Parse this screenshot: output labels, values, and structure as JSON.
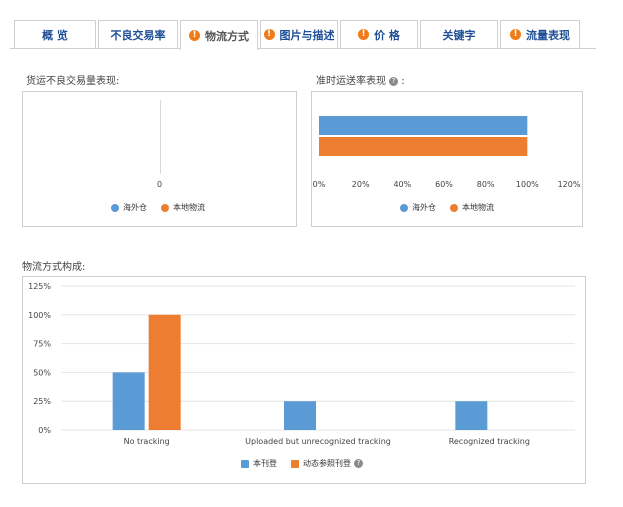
{
  "tabs": [
    {
      "label": "概 览",
      "warning": false
    },
    {
      "label": "不良交易率",
      "warning": false
    },
    {
      "label": "物流方式",
      "warning": true,
      "active": true
    },
    {
      "label": "图片与描述",
      "warning": true
    },
    {
      "label": "价 格",
      "warning": true
    },
    {
      "label": "关键字",
      "warning": false
    },
    {
      "label": "流量表现",
      "warning": true
    }
  ],
  "colors": {
    "blue": "#5b9bd5",
    "orange": "#ed7d31",
    "tab_text": "#1f4f96",
    "warning": "#f07b19"
  },
  "bad_trade": {
    "title": "货运不良交易量表现:",
    "zero_label": "0",
    "legend": [
      "海外仓",
      "本地物流"
    ]
  },
  "ontime": {
    "title": "准时运送率表现",
    "title_suffix": ":",
    "legend": [
      "海外仓",
      "本地物流"
    ]
  },
  "composition": {
    "title": "物流方式构成:",
    "legend": [
      "本刊登",
      "动态参照刊登"
    ]
  },
  "chart_data": [
    {
      "type": "bar",
      "orientation": "horizontal",
      "title": "准时运送率表现",
      "x_ticks": [
        "0%",
        "20%",
        "40%",
        "60%",
        "80%",
        "100%",
        "120%"
      ],
      "xlim": [
        0,
        120
      ],
      "series": [
        {
          "name": "海外仓",
          "values": [
            100
          ]
        },
        {
          "name": "本地物流",
          "values": [
            100
          ]
        }
      ]
    },
    {
      "type": "bar",
      "title": "物流方式构成",
      "categories": [
        "No tracking",
        "Uploaded but unrecognized tracking",
        "Recognized tracking"
      ],
      "y_ticks": [
        "0%",
        "25%",
        "50%",
        "75%",
        "100%",
        "125%"
      ],
      "ylim": [
        0,
        125
      ],
      "series": [
        {
          "name": "本刊登",
          "values": [
            50,
            25,
            25
          ]
        },
        {
          "name": "动态参照刊登",
          "values": [
            100,
            0,
            0
          ]
        }
      ]
    }
  ]
}
